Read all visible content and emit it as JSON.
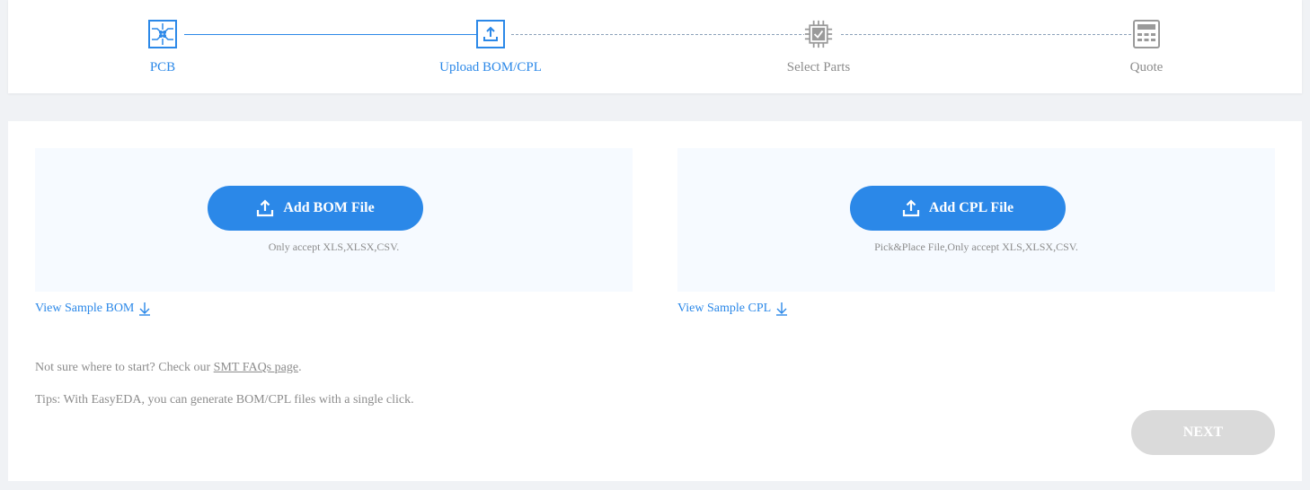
{
  "steps": [
    {
      "label": "PCB",
      "icon": "pcb-icon",
      "state": "done"
    },
    {
      "label": "Upload BOM/CPL",
      "icon": "upload-icon",
      "state": "current"
    },
    {
      "label": "Select Parts",
      "icon": "chip-icon",
      "state": "pending"
    },
    {
      "label": "Quote",
      "icon": "calculator-icon",
      "state": "pending"
    }
  ],
  "bom": {
    "button_label": "Add BOM File",
    "hint": "Only accept XLS,XLSX,CSV.",
    "sample_link": "View Sample BOM"
  },
  "cpl": {
    "button_label": "Add CPL File",
    "hint": "Pick&Place File,Only accept XLS,XLSX,CSV.",
    "sample_link": "View Sample CPL"
  },
  "notes": {
    "faq_prefix": "Not sure where to start? Check our ",
    "faq_link": "SMT FAQs page",
    "faq_suffix": ".",
    "tips": "Tips: With EasyEDA, you can generate BOM/CPL files with a single click."
  },
  "next_label": "NEXT",
  "colors": {
    "accent": "#2b88e8",
    "inactive": "#8c8c8c",
    "disabled_button": "#dadada"
  }
}
